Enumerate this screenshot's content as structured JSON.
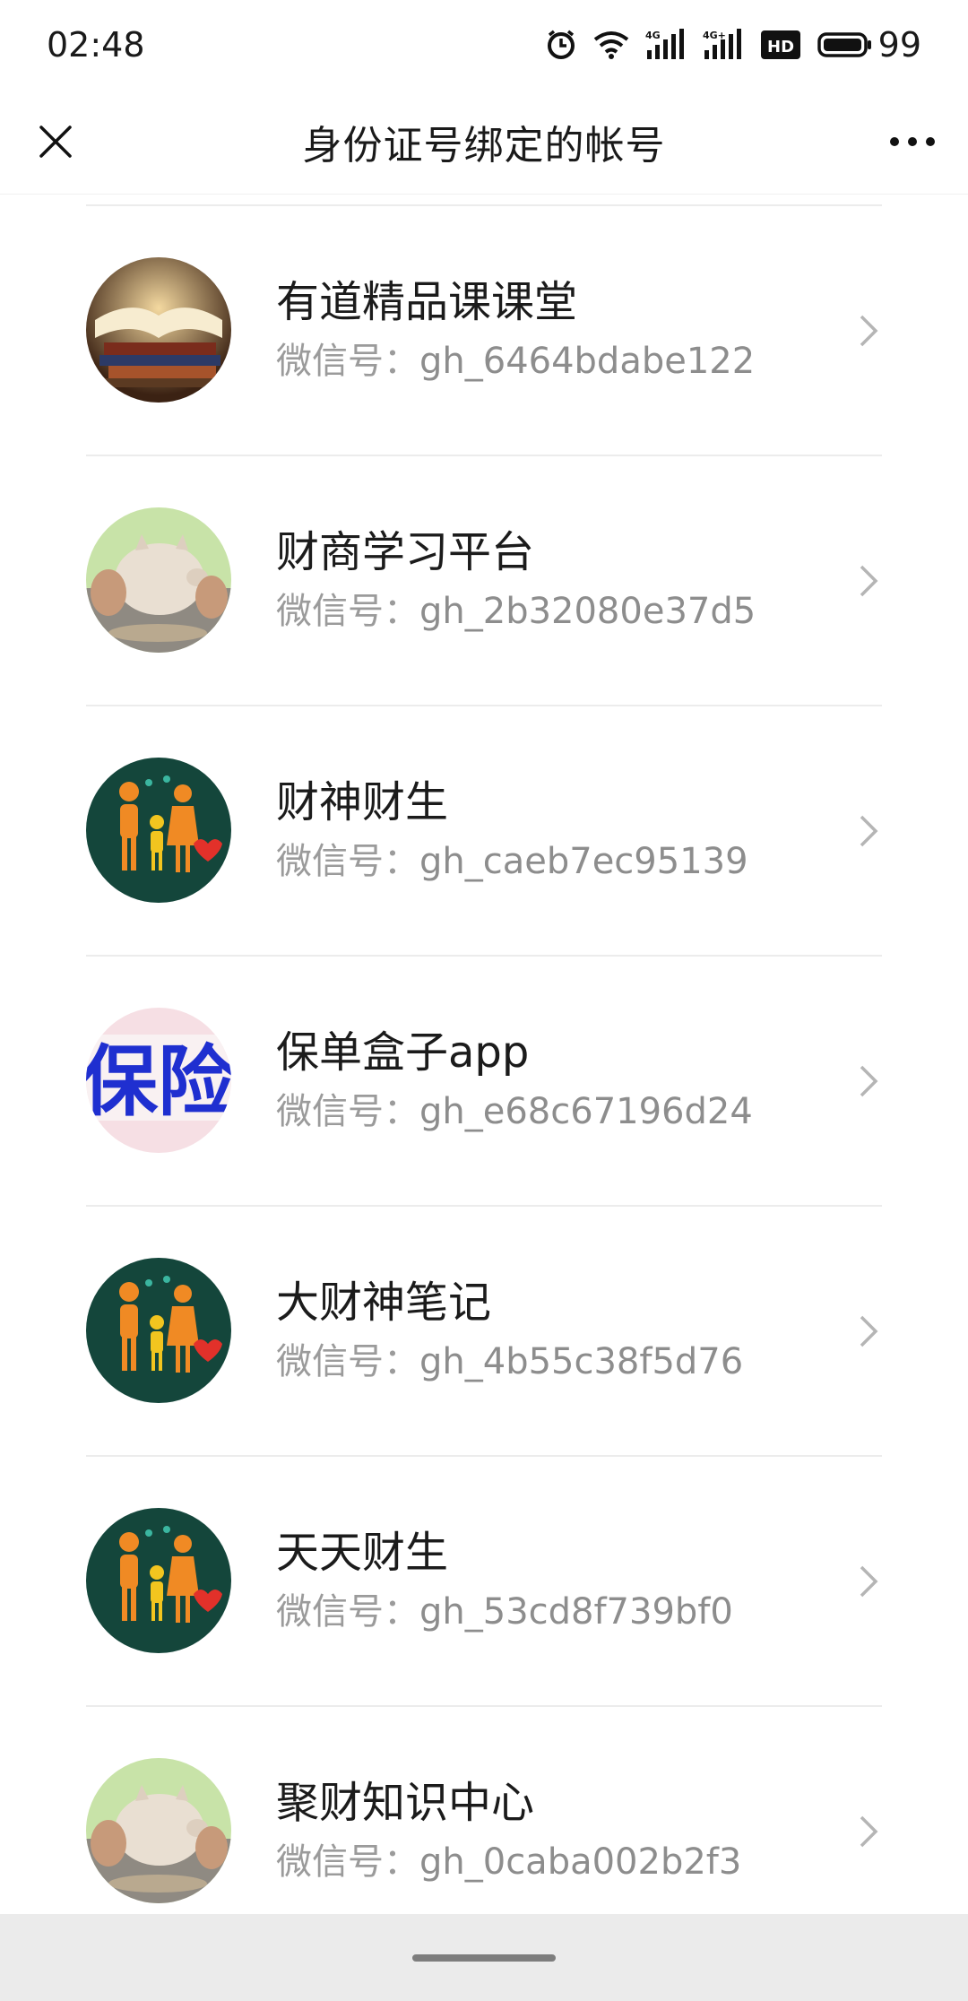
{
  "status": {
    "time": "02:48",
    "network_1": "4G",
    "network_2": "4G+",
    "hd_badge": "HD",
    "battery": "99"
  },
  "nav": {
    "title": "身份证号绑定的帐号",
    "close_icon": "close-icon",
    "more_icon": "more-icon"
  },
  "accounts": [
    {
      "name": "有道精品课课堂",
      "id_prefix": "微信号：",
      "id": "gh_6464bdabe122",
      "avatar": "books"
    },
    {
      "name": "财商学习平台",
      "id_prefix": "微信号：",
      "id": "gh_2b32080e37d5",
      "avatar": "piggy"
    },
    {
      "name": "财神财生",
      "id_prefix": "微信号：",
      "id": "gh_caeb7ec95139",
      "avatar": "family"
    },
    {
      "name": "保单盒子app",
      "id_prefix": "微信号：",
      "id": "gh_e68c67196d24",
      "avatar": "baoxian"
    },
    {
      "name": "大财神笔记",
      "id_prefix": "微信号：",
      "id": "gh_4b55c38f5d76",
      "avatar": "family"
    },
    {
      "name": "天天财生",
      "id_prefix": "微信号：",
      "id": "gh_53cd8f739bf0",
      "avatar": "family"
    },
    {
      "name": "聚财知识中心",
      "id_prefix": "微信号：",
      "id": "gh_0caba002b2f3",
      "avatar": "piggy"
    }
  ]
}
